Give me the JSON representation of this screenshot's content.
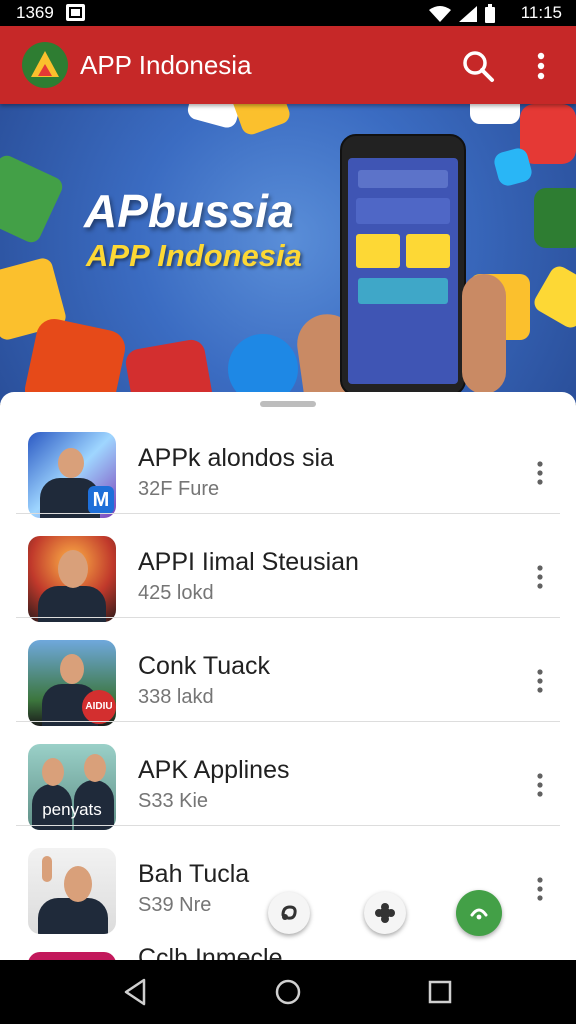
{
  "status_bar": {
    "time_left": "1369",
    "time_right": "11:15"
  },
  "app_bar": {
    "title": "APP Indonesia",
    "search_icon": "search-icon",
    "more_icon": "more-vert-icon"
  },
  "banner": {
    "headline": "APbussia",
    "subheadline": "APP Indonesia"
  },
  "apps": [
    {
      "name": "APPk alondos sia",
      "detail": "32F Fure",
      "thumb_label": "M"
    },
    {
      "name": "APPI Iimal Steusian",
      "detail": "425 lokd",
      "thumb_label": ""
    },
    {
      "name": "Conk Tuack",
      "detail": "338 lakd",
      "thumb_label": "AIDIU"
    },
    {
      "name": "APK Applines",
      "detail": "S33 Kie",
      "thumb_label": "penyats"
    },
    {
      "name": "Bah Tucla",
      "detail": "S39 Nre",
      "thumb_label": ""
    },
    {
      "name": "Cclh Inmecle",
      "detail": "",
      "thumb_label": ""
    }
  ],
  "colors": {
    "app_bar": "#c62828",
    "fab_green": "#43a047"
  }
}
